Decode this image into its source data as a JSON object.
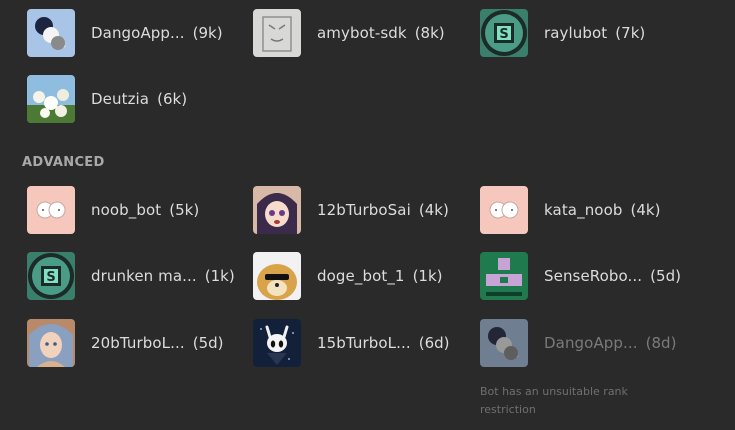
{
  "bots_top": [
    {
      "name": "DangoApp...",
      "count": "(9k)",
      "avatar": "dango-avatar"
    },
    {
      "name": "amybot-sdk",
      "count": "(8k)",
      "avatar": "sketch-avatar"
    },
    {
      "name": "raylubot",
      "count": "(7k)",
      "avatar": "circuit-s-avatar"
    },
    {
      "name": "Deutzia",
      "count": "(6k)",
      "avatar": "flowers-avatar"
    }
  ],
  "advanced": {
    "label": "ADVANCED",
    "bots": [
      {
        "name": "noob_bot",
        "count": "(5k)",
        "avatar": "sheep-avatar"
      },
      {
        "name": "12bTurboSai",
        "count": "(4k)",
        "avatar": "anime-girl-avatar"
      },
      {
        "name": "kata_noob",
        "count": "(4k)",
        "avatar": "sheep-avatar"
      },
      {
        "name": "drunken ma...",
        "count": "(1k)",
        "avatar": "circuit-s-avatar"
      },
      {
        "name": "doge_bot_1",
        "count": "(1k)",
        "avatar": "doge-avatar"
      },
      {
        "name": "SenseRobo...",
        "count": "(5d)",
        "avatar": "green-robot-avatar"
      },
      {
        "name": "20bTurboL...",
        "count": "(5d)",
        "avatar": "portrait-avatar"
      },
      {
        "name": "15bTurboL...",
        "count": "(6d)",
        "avatar": "hollow-knight-avatar"
      },
      {
        "name": "DangoApp...",
        "count": "(8d)",
        "avatar": "dango-avatar",
        "disabled": true
      }
    ],
    "note": "Bot has an unsuitable rank restriction"
  }
}
